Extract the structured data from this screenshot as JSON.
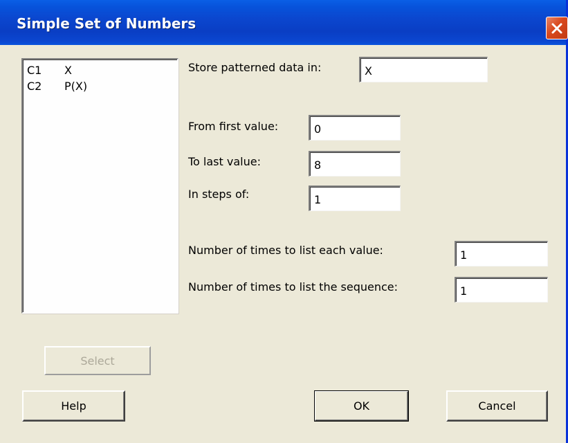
{
  "window": {
    "title": "Simple Set of Numbers"
  },
  "variables": [
    {
      "column": "C1",
      "name": "X"
    },
    {
      "column": "C2",
      "name": "P(X)"
    }
  ],
  "form": {
    "store_label": "Store patterned data in:",
    "store_value": "X",
    "from_label": "From first value:",
    "from_value": "0",
    "to_label": "To last value:",
    "to_value": "8",
    "steps_label": "In steps of:",
    "steps_value": "1",
    "times_each_label": "Number of times to list each value:",
    "times_each_value": "1",
    "times_seq_label": "Number of times to list the sequence:",
    "times_seq_value": "1"
  },
  "buttons": {
    "select": "Select",
    "help": "Help",
    "ok": "OK",
    "cancel": "Cancel"
  },
  "colors": {
    "titlebar": "#0a3ec4",
    "close": "#d9481c",
    "face": "#ece9d8"
  },
  "icons": {
    "close": "close-icon"
  }
}
